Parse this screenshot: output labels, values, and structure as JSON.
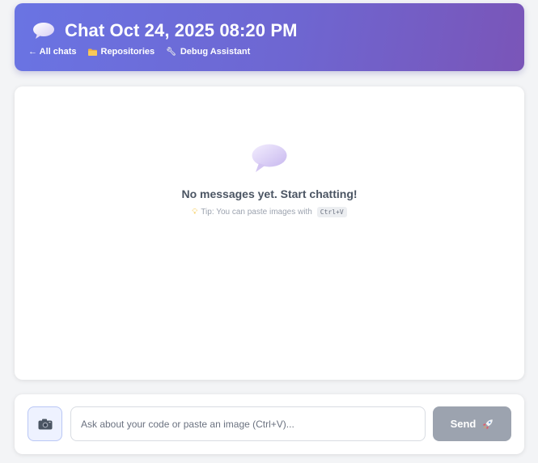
{
  "header": {
    "title": "Chat Oct 24, 2025 08:20 PM",
    "title_icon": "speech-bubble-icon",
    "breadcrumbs": [
      {
        "label": "← All chats"
      },
      {
        "label": "Repositories",
        "icon": "folder-icon"
      },
      {
        "label": "Debug Assistant",
        "icon": "wrench-icon"
      }
    ],
    "gradient_colors": [
      "#6a74e3",
      "#7a55b8"
    ]
  },
  "chat": {
    "empty_icon": "speech-bubble-icon",
    "empty_title": "No messages yet. Start chatting!",
    "tip_icon": "lightbulb-icon",
    "tip_text": "Tip: You can paste images with",
    "tip_shortcut": "Ctrl+V"
  },
  "composer": {
    "image_button_icon": "camera-icon",
    "input_value": "",
    "input_placeholder": "Ask about your code or paste an image (Ctrl+V)...",
    "send_label": "Send",
    "send_icon": "rocket-icon",
    "send_color": "#9ca3af"
  }
}
